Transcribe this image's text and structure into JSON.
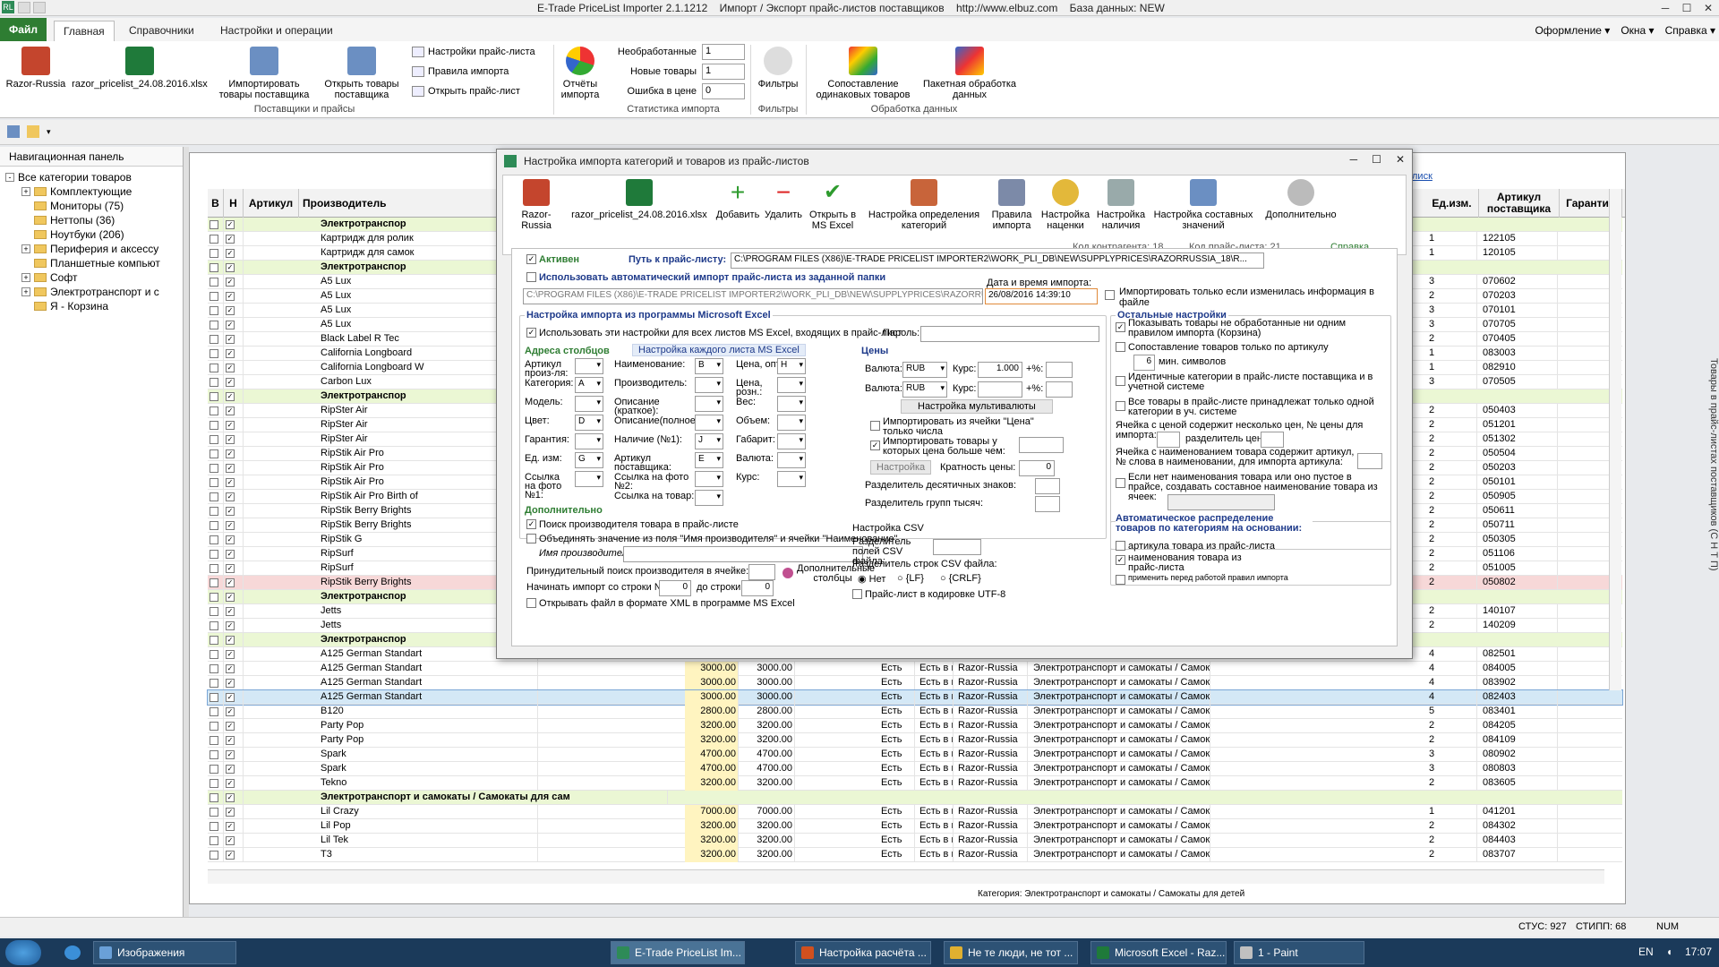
{
  "window": {
    "title": "E-Trade PriceList Importer 2.1.1212    Импорт / Экспорт прайс-листов поставщиков    http://www.elbuz.com    База данных: NEW",
    "app_icon": "RL"
  },
  "menu": {
    "file": "Файл",
    "tabs": [
      "Главная",
      "Справочники",
      "Настройки и операции"
    ],
    "right": [
      "Оформление ▾",
      "Окна ▾",
      "Справка ▾"
    ]
  },
  "ribbon": {
    "supplier": "Razor-Russia",
    "file": "razor_pricelist_24.08.2016.xlsx",
    "import_btn": "Импортировать товары поставщика",
    "open_btn": "Открыть товары поставщика",
    "group1": "Поставщики и прайсы",
    "small": [
      "Настройки прайс-листа",
      "Правила импорта",
      "Открыть прайс-лист"
    ],
    "reports": "Отчёты импорта",
    "stats": [
      {
        "label": "Необработанные",
        "value": "1"
      },
      {
        "label": "Новые товары",
        "value": "1"
      },
      {
        "label": "Ошибка в цене",
        "value": "0"
      }
    ],
    "group2": "Статистика импорта",
    "filters": "Фильтры",
    "group3": "Фильтры",
    "match": "Сопоставление одинаковых товаров",
    "batch": "Пакетная обработка данных",
    "group4": "Обработка данных"
  },
  "nav": {
    "title": "Навигационная панель",
    "items": [
      {
        "label": "Все категории товаров",
        "exp": "-",
        "lvl": 0
      },
      {
        "label": "Комплектующие",
        "exp": "+",
        "lvl": 1
      },
      {
        "label": "Мониторы (75)",
        "exp": "",
        "lvl": 1
      },
      {
        "label": "Неттопы (36)",
        "exp": "",
        "lvl": 1
      },
      {
        "label": "Ноутбуки (206)",
        "exp": "",
        "lvl": 1
      },
      {
        "label": "Периферия и аксессу",
        "exp": "+",
        "lvl": 1
      },
      {
        "label": "Планшетные компьют",
        "exp": "",
        "lvl": 1
      },
      {
        "label": "Софт",
        "exp": "+",
        "lvl": 1
      },
      {
        "label": "Электротранспорт и с",
        "exp": "+",
        "lvl": 1
      },
      {
        "label": "Я - Корзина",
        "exp": "",
        "lvl": 1
      }
    ]
  },
  "grid": {
    "headers": {
      "v": "В",
      "n": "Н",
      "art": "Артикул",
      "prod": "Производитель",
      "unit": "Ед.изм.",
      "supart": "Артикул поставщика",
      "warr": "Гарантия"
    },
    "link": "лиск",
    "rows": [
      {
        "t": "g",
        "name": "Электротранспор"
      },
      {
        "name": "Картридж для ролик",
        "u": "1",
        "a": "122105"
      },
      {
        "name": "Картридж для самок",
        "u": "1",
        "a": "120105"
      },
      {
        "t": "g",
        "name": "Электротранспор"
      },
      {
        "name": "A5 Lux",
        "u": "3",
        "a": "070602"
      },
      {
        "name": "A5 Lux",
        "u": "2",
        "a": "070203"
      },
      {
        "name": "A5 Lux",
        "u": "3",
        "a": "070101"
      },
      {
        "name": "A5 Lux",
        "u": "3",
        "a": "070705"
      },
      {
        "name": "Black Label R Tec",
        "u": "2",
        "a": "070405"
      },
      {
        "name": "California Longboard",
        "u": "1",
        "a": "083003"
      },
      {
        "name": "California Longboard W",
        "u": "1",
        "a": "082910"
      },
      {
        "name": "Carbon Lux",
        "u": "3",
        "a": "070505"
      },
      {
        "t": "g",
        "name": "Электротранспор"
      },
      {
        "name": "RipSter Air",
        "u": "2",
        "a": "050403"
      },
      {
        "name": "RipSter Air",
        "u": "2",
        "a": "051201"
      },
      {
        "name": "RipSter Air",
        "u": "2",
        "a": "051302"
      },
      {
        "name": "RipStik Air Pro",
        "u": "2",
        "a": "050504"
      },
      {
        "name": "RipStik Air Pro",
        "u": "2",
        "a": "050203"
      },
      {
        "name": "RipStik Air Pro",
        "u": "2",
        "a": "050101"
      },
      {
        "name": "RipStik Air Pro Birth of",
        "u": "2",
        "a": "050905"
      },
      {
        "name": "RipStik Berry Brights",
        "u": "2",
        "a": "050611"
      },
      {
        "name": "RipStik Berry Brights",
        "u": "2",
        "a": "050711"
      },
      {
        "name": "RipStik G",
        "u": "2",
        "a": "050305"
      },
      {
        "name": "RipSurf",
        "u": "2",
        "a": "051106"
      },
      {
        "name": "RipSurf",
        "u": "2",
        "a": "051005"
      },
      {
        "t": "p",
        "name": "RipStik Berry Brights",
        "u": "2",
        "a": "050802"
      },
      {
        "t": "g",
        "name": "Электротранспор"
      },
      {
        "name": "Jetts",
        "u": "2",
        "a": "140107"
      },
      {
        "name": "Jetts",
        "u": "2",
        "a": "140209"
      },
      {
        "t": "g",
        "name": "Электротранспор"
      },
      {
        "name": "A125 German Standart",
        "u": "4",
        "a": "082501"
      },
      {
        "name": "A125 German Standart",
        "p1": "3000.00",
        "p2": "3000.00",
        "s": "Есть",
        "s2": "Есть в н",
        "sup": "Razor-Russia",
        "cat": "Электротранспорт и самокаты / Самок",
        "u": "4",
        "a": "084005"
      },
      {
        "name": "A125 German Standart",
        "p1": "3000.00",
        "p2": "3000.00",
        "s": "Есть",
        "s2": "Есть в н",
        "sup": "Razor-Russia",
        "cat": "Электротранспорт и самокаты / Самок",
        "u": "4",
        "a": "083902"
      },
      {
        "t": "s",
        "name": "A125 German Standart",
        "p1": "3000.00",
        "p2": "3000.00",
        "s": "Есть",
        "s2": "Есть в н",
        "sup": "Razor-Russia",
        "cat": "Электротранспорт и самокаты / Самок",
        "u": "4",
        "a": "082403"
      },
      {
        "name": "B120",
        "p1": "2800.00",
        "p2": "2800.00",
        "s": "Есть",
        "s2": "Есть в н",
        "sup": "Razor-Russia",
        "cat": "Электротранспорт и самокаты / Самок",
        "u": "5",
        "a": "083401"
      },
      {
        "name": "Party Pop",
        "p1": "3200.00",
        "p2": "3200.00",
        "s": "Есть",
        "s2": "Есть в н",
        "sup": "Razor-Russia",
        "cat": "Электротранспорт и самокаты / Самок",
        "u": "2",
        "a": "084205"
      },
      {
        "name": "Party Pop",
        "p1": "3200.00",
        "p2": "3200.00",
        "s": "Есть",
        "s2": "Есть в н",
        "sup": "Razor-Russia",
        "cat": "Электротранспорт и самокаты / Самок",
        "u": "2",
        "a": "084109"
      },
      {
        "name": "Spark",
        "p1": "4700.00",
        "p2": "4700.00",
        "s": "Есть",
        "s2": "Есть в н",
        "sup": "Razor-Russia",
        "cat": "Электротранспорт и самокаты / Самок",
        "u": "3",
        "a": "080902"
      },
      {
        "name": "Spark",
        "p1": "4700.00",
        "p2": "4700.00",
        "s": "Есть",
        "s2": "Есть в н",
        "sup": "Razor-Russia",
        "cat": "Электротранспорт и самокаты / Самок",
        "u": "3",
        "a": "080803"
      },
      {
        "name": "Tekno",
        "p1": "3200.00",
        "p2": "3200.00",
        "s": "Есть",
        "s2": "Есть в н",
        "sup": "Razor-Russia",
        "cat": "Электротранспорт и самокаты / Самок",
        "u": "2",
        "a": "083605"
      },
      {
        "t": "g",
        "name": "Электротранспорт и самокаты / Самокаты для сам"
      },
      {
        "name": "Lil Crazy",
        "p1": "7000.00",
        "p2": "7000.00",
        "s": "Есть",
        "s2": "Есть в н",
        "sup": "Razor-Russia",
        "cat": "Электротранспорт и самокаты / Самок",
        "u": "1",
        "a": "041201"
      },
      {
        "name": "Lil Pop",
        "p1": "3200.00",
        "p2": "3200.00",
        "s": "Есть",
        "s2": "Есть в н",
        "sup": "Razor-Russia",
        "cat": "Электротранспорт и самокаты / Самок",
        "u": "2",
        "a": "084302"
      },
      {
        "name": "Lil Tek",
        "p1": "3200.00",
        "p2": "3200.00",
        "s": "Есть",
        "s2": "Есть в н",
        "sup": "Razor-Russia",
        "cat": "Электротранспорт и самокаты / Самок",
        "u": "2",
        "a": "084403"
      },
      {
        "name": "T3",
        "p1": "3200.00",
        "p2": "3200.00",
        "s": "Есть",
        "s2": "Есть в н",
        "sup": "Razor-Russia",
        "cat": "Электротранспорт и самокаты / Самок",
        "u": "2",
        "a": "083707"
      }
    ],
    "footer": "Категория:  Электротранспорт и самокаты / Самокаты для детей"
  },
  "dialog": {
    "title": "Настройка импорта категорий и товаров из прайс-листов",
    "toolbar": [
      "Razor-Russia",
      "razor_pricelist_24.08.2016.xlsx",
      "Добавить",
      "Удалить",
      "Открыть в MS Excel",
      "Настройка определения категорий",
      "Правила импорта",
      "Настройка наценки",
      "Настройка наличия",
      "Настройка составных значений",
      "Дополнительно"
    ],
    "kontr": "Код контрагента: 18",
    "price_code": "Код прайс-листа: 21",
    "help": "Справка",
    "active": "Активен",
    "path_label": "Путь к прайс-листу:",
    "path_value": "C:\\PROGRAM FILES (X86)\\E-TRADE PRICELIST IMPORTER2\\WORK_PLI_DB\\NEW\\SUPPLYPRICES\\RAZORRUSSIA_18\\R...",
    "auto_import": "Использовать автоматический импорт прайс-листа из заданной папки",
    "auto_path": "C:\\PROGRAM FILES (X86)\\E-TRADE PRICELIST IMPORTER2\\WORK_PLI_DB\\NEW\\SUPPLYPRICES\\RAZORRU",
    "date_label": "Дата и время импорта:",
    "date_value": "26/08/2016 14:39:10",
    "only_changed": "Импортировать только если изменилась информация в файле",
    "excel_section": "Настройка импорта из программы Microsoft Excel",
    "use_all": "Использовать эти настройки для всех листов MS Excel, входящих в прайс-лист",
    "password": "Пароль:",
    "addr": "Адреса столбцов",
    "each_sheet": "Настройка каждого листа MS Excel",
    "prices": "Цены",
    "cols_left": [
      {
        "l": "Артикул произ-ля:",
        "v": ""
      },
      {
        "l": "Категория:",
        "v": "A"
      },
      {
        "l": "Модель:",
        "v": ""
      },
      {
        "l": "Цвет:",
        "v": "D"
      },
      {
        "l": "Гарантия:",
        "v": ""
      },
      {
        "l": "Ед. изм:",
        "v": "G"
      },
      {
        "l": "Ссылка на фото №1:",
        "v": ""
      }
    ],
    "cols_mid": [
      {
        "l": "Наименование:",
        "v": "B"
      },
      {
        "l": "Производитель:",
        "v": ""
      },
      {
        "l": "Описание (краткое):",
        "v": ""
      },
      {
        "l": "Описание(полное):",
        "v": ""
      },
      {
        "l": "Наличие (№1):",
        "v": "J"
      },
      {
        "l": "Артикул поставщика:",
        "v": "E"
      },
      {
        "l": "Ссылка на фото №2:",
        "v": ""
      },
      {
        "l": "Ссылка на товар:",
        "v": ""
      }
    ],
    "cols_right": [
      {
        "l": "Цена, опт:",
        "v": "H"
      },
      {
        "l": "Цена, розн.:",
        "v": ""
      },
      {
        "l": "Вес:",
        "v": ""
      },
      {
        "l": "Объем:",
        "v": ""
      },
      {
        "l": "Габарит:",
        "v": ""
      },
      {
        "l": "Валюта:",
        "v": ""
      },
      {
        "l": "Курс:",
        "v": ""
      }
    ],
    "extra_cols": "Дополнительные столбцы",
    "currency1": "RUB",
    "currency2": "RUB",
    "rate_label": "Курс:",
    "rate_value": "1.000",
    "pct": "+%:",
    "currency_label": "Валюта:",
    "multi_cur": "Настройка мультивалюты",
    "import_price_cell": "Импортировать из ячейки \"Цена\" только числа",
    "import_price_gt": "Импортировать товары у которых цена больше чем:",
    "setup": "Настройка",
    "multiple": "Кратность цены:",
    "multiple_v": "0",
    "dec_sep": "Разделитель десятичных знаков:",
    "grp_sep": "Разделитель групп тысяч:",
    "extra": "Дополнительно",
    "find_prod": "Поиск производителя товара в прайс-листе",
    "merge": "Объединять значение из поля \"Имя производителя\" и ячейки \"Наименование\"",
    "prod_name": "Имя производителя:",
    "force": "Принудительный поиск производителя в ячейке:",
    "start_row": "Начинать импорт со строки №:",
    "start_v": "0",
    "to_row": "до строки:",
    "to_v": "0",
    "xml": "Открывать файл в формате XML в программе MS Excel",
    "csv": "Настройка CSV",
    "csv_field": "Разделитель полей CSV файла:",
    "csv_row": "Разделитель строк CSV файла:",
    "csv_opts": [
      "Нет",
      "{LF}",
      "{CRLF}"
    ],
    "utf8": "Прайс-лист в кодировке UTF-8",
    "other": "Остальные настройки",
    "other_items": [
      "Показывать товары не обработанные ни одним правилом импорта (Корзина)",
      "Сопоставление товаров только по артикулу",
      "Идентичные категории в прайс-листе поставщика и в учетной системе",
      "Все товары в прайс-листе принадлежат только одной категории в уч. системе"
    ],
    "min_syms": "мин. символов",
    "min_v": "6",
    "cell_several": "Ячейка с ценой содержит несколько цен, № цены для импорта:",
    "price_sep": "разделитель цены:",
    "cell_name_art": "Ячейка с наименованием товара содержит артикул, № слова в наименовании, для импорта артикула:",
    "no_name": "Если нет наименования товара или оно пустое в прайсе, создавать составное наименование товара из ячеек:",
    "auto_dist": "Автоматическое распределение товаров по категориям на основании:",
    "auto_items": [
      "артикула товара из прайс-листа",
      "наименования товара из прайс-листа",
      "применить перед работой правил импорта"
    ]
  },
  "status": {
    "left": "",
    "s1": "СТУС: 927",
    "s2": "СТИПП: 68",
    "s3": "NUM"
  },
  "side_tab": "Товары в прайс-листах поставщиков (С Н Т П)",
  "taskbar": {
    "items": [
      {
        "label": "Изображения",
        "color": "#6aa0d8"
      },
      {
        "label": "E-Trade PriceList Im...",
        "color": "#2e8b57",
        "active": true
      },
      {
        "label": "Настройка расчёта ...",
        "color": "#d0501e"
      },
      {
        "label": "Не те люди, не тот ...",
        "color": "#e0b030"
      },
      {
        "label": "Microsoft Excel - Raz...",
        "color": "#1f7a3a"
      },
      {
        "label": "1 - Paint",
        "color": "#c0c0c0"
      }
    ],
    "lang": "EN",
    "time": "17:07"
  }
}
